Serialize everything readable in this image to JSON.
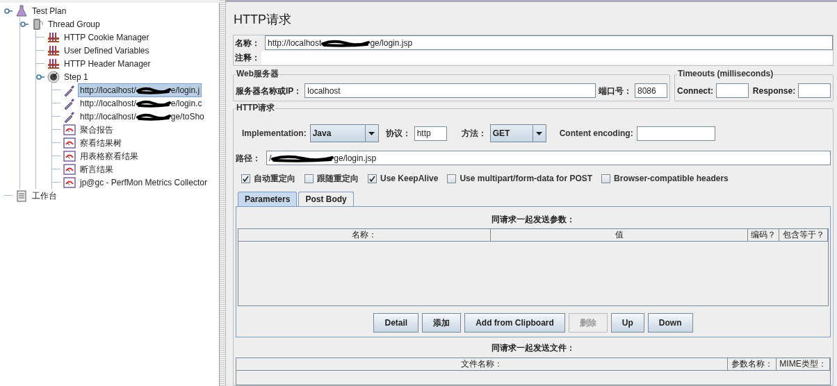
{
  "tree": [
    {
      "label": "Test Plan",
      "kind": "flask",
      "expanded": true,
      "children": [
        {
          "label": "Thread Group",
          "kind": "spool",
          "expanded": true,
          "children": [
            {
              "label": "HTTP Cookie Manager",
              "kind": "config"
            },
            {
              "label": "User Defined Variables",
              "kind": "config"
            },
            {
              "label": "HTTP Header Manager",
              "kind": "config"
            },
            {
              "label": "Step 1",
              "kind": "step",
              "expanded": true,
              "children": [
                {
                  "label": "http://localhost/",
                  "hidden_tail": "e/login.j",
                  "kind": "sampler",
                  "selected": true
                },
                {
                  "label": "http://localhost/",
                  "hidden_tail": "e/login.c",
                  "kind": "sampler",
                  "selected": false
                },
                {
                  "label": "http://localhost/",
                  "hidden_tail": "ge/toSho",
                  "kind": "sampler",
                  "selected": false
                },
                {
                  "label": "聚合报告",
                  "kind": "listener",
                  "selected": false
                },
                {
                  "label": "察看结果树",
                  "kind": "listener",
                  "selected": false
                },
                {
                  "label": "用表格察看结果",
                  "kind": "listener",
                  "selected": false
                },
                {
                  "label": "断言结果",
                  "kind": "listener",
                  "selected": false
                },
                {
                  "label": "jp@gc - PerfMon Metrics Collector",
                  "kind": "listener",
                  "selected": false
                }
              ]
            }
          ]
        }
      ]
    },
    {
      "label": "工作台",
      "kind": "workbench"
    }
  ],
  "title": "HTTP请求",
  "name_field": {
    "label": "名称：",
    "value_head": "http://localhost",
    "value_tail": "ge/login.jsp"
  },
  "comment_field": {
    "label": "注释："
  },
  "web_server": {
    "legend": "Web服务器",
    "server_label": "服务器名称或IP：",
    "server_value": "localhost",
    "port_label": "端口号：",
    "port_value": "8086"
  },
  "timeouts": {
    "legend": "Timeouts (milliseconds)",
    "connect_label": "Connect:",
    "response_label": "Response:"
  },
  "http_request": {
    "legend": "HTTP请求",
    "implementation_label": "Implementation:",
    "implementation_value": "Java",
    "protocol_label": "协议：",
    "protocol_value": "http",
    "method_label": "方法：",
    "method_value": "GET",
    "encoding_label": "Content encoding:",
    "path_label": "路径：",
    "path_head": "/",
    "path_tail": "ge/login.jsp"
  },
  "options": [
    {
      "label": "自动重定向",
      "checked": true
    },
    {
      "label": "跟随重定向",
      "checked": false
    },
    {
      "label": "Use KeepAlive",
      "checked": true
    },
    {
      "label": "Use multipart/form-data for POST",
      "checked": false
    },
    {
      "label": "Browser-compatible headers",
      "checked": false
    }
  ],
  "tabs": [
    {
      "label": "Parameters",
      "selected": true
    },
    {
      "label": "Post Body",
      "selected": false
    }
  ],
  "params": {
    "title": "同请求一起发送参数：",
    "columns": [
      "名称：",
      "值",
      "编码？",
      "包含等于？"
    ]
  },
  "buttons": [
    {
      "label": "Detail",
      "disabled": false
    },
    {
      "label": "添加",
      "disabled": false
    },
    {
      "label": "Add from Clipboard",
      "disabled": false
    },
    {
      "label": "删除",
      "disabled": true
    },
    {
      "label": "Up",
      "disabled": false
    },
    {
      "label": "Down",
      "disabled": false
    }
  ],
  "files": {
    "title": "同请求一起发送文件：",
    "columns": [
      "文件名称：",
      "参数名称：",
      "MIME类型："
    ]
  }
}
